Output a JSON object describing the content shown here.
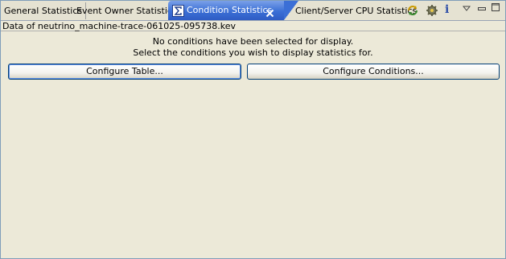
{
  "tabs": [
    {
      "label": "General Statistics",
      "active": false
    },
    {
      "label": "Event Owner Statistics",
      "active": false
    },
    {
      "label": "Condition Statistics",
      "active": true
    },
    {
      "label": "Client/Server CPU Statistics",
      "active": false
    }
  ],
  "toolbar": {
    "icons": [
      "refresh-icon",
      "gear-icon",
      "info-icon",
      "view-menu-icon",
      "minimize-icon",
      "maximize-icon"
    ],
    "info_glyph": "i"
  },
  "status": {
    "text": "Data of neutrino_machine-trace-061025-095738.kev"
  },
  "message": {
    "line1": "No conditions have been selected for display.",
    "line2": "Select the conditions you wish to display statistics for."
  },
  "buttons": {
    "configure_table": "Configure Table...",
    "configure_conditions": "Configure Conditions..."
  },
  "colors": {
    "background": "#ECE9D8",
    "active_tab": "#3B6FD6",
    "border": "#7F9DB9"
  }
}
